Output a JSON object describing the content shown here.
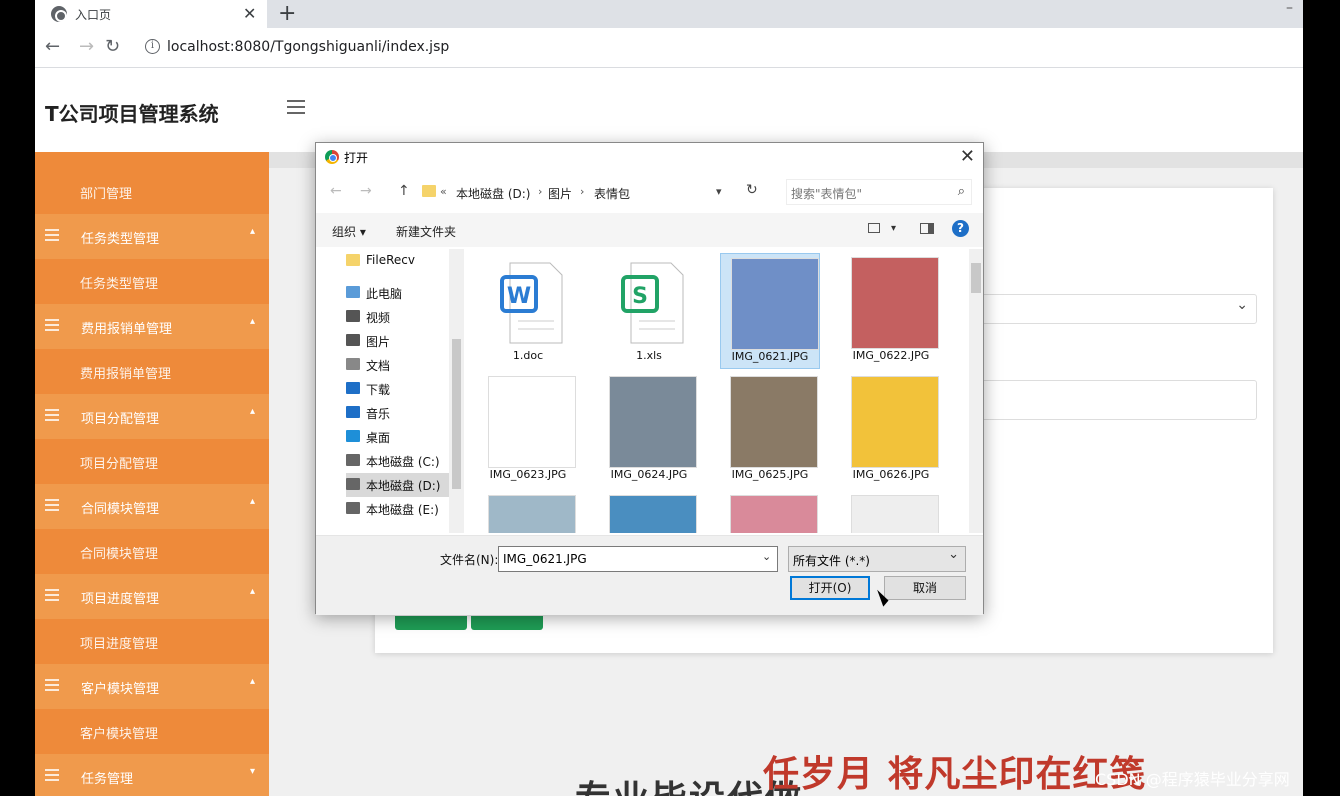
{
  "browser": {
    "tab_title": "入口页",
    "tab_close": "✕",
    "new_tab": "+",
    "url": "localhost:8080/Tgongshiguanli/index.jsp"
  },
  "app": {
    "title": "T公司项目管理系统"
  },
  "sidebar": {
    "items": [
      {
        "label": "部门管理",
        "type": "item"
      },
      {
        "label": "任务类型管理",
        "type": "group"
      },
      {
        "label": "任务类型管理",
        "type": "item"
      },
      {
        "label": "费用报销单管理",
        "type": "group"
      },
      {
        "label": "费用报销单管理",
        "type": "item"
      },
      {
        "label": "项目分配管理",
        "type": "group"
      },
      {
        "label": "项目分配管理",
        "type": "item"
      },
      {
        "label": "合同模块管理",
        "type": "group"
      },
      {
        "label": "合同模块管理",
        "type": "item"
      },
      {
        "label": "项目进度管理",
        "type": "group"
      },
      {
        "label": "项目进度管理",
        "type": "item"
      },
      {
        "label": "客户模块管理",
        "type": "group"
      },
      {
        "label": "客户模块管理",
        "type": "item"
      },
      {
        "label": "任务管理",
        "type": "group"
      }
    ]
  },
  "dialog": {
    "title": "打开",
    "path": [
      "本地磁盘 (D:)",
      "图片",
      "表情包"
    ],
    "search_placeholder": "搜索\"表情包\"",
    "toolbar": {
      "organize": "组织 ▾",
      "new_folder": "新建文件夹",
      "help": "?"
    },
    "nav": [
      {
        "label": "FileRecv",
        "color": "#f5d36a"
      },
      {
        "label": "此电脑",
        "color": "#5a9bd8"
      },
      {
        "label": "视频",
        "color": "#555555"
      },
      {
        "label": "图片",
        "color": "#555555"
      },
      {
        "label": "文档",
        "color": "#888888"
      },
      {
        "label": "下载",
        "color": "#1e6fc7"
      },
      {
        "label": "音乐",
        "color": "#1e6fc7"
      },
      {
        "label": "桌面",
        "color": "#1e8fd8"
      },
      {
        "label": "本地磁盘 (C:)",
        "color": "#666666"
      },
      {
        "label": "本地磁盘 (D:)",
        "color": "#666666"
      },
      {
        "label": "本地磁盘 (E:)",
        "color": "#666666"
      }
    ],
    "files": [
      {
        "name": "1.doc",
        "kind": "doc",
        "color": "#2b7cd3"
      },
      {
        "name": "1.xls",
        "kind": "xls",
        "color": "#21a366"
      },
      {
        "name": "IMG_0621.JPG",
        "kind": "img",
        "color": "#6f8fc7"
      },
      {
        "name": "IMG_0622.JPG",
        "kind": "img",
        "color": "#c46060"
      },
      {
        "name": "IMG_0623.JPG",
        "kind": "img",
        "color": "#ffffff"
      },
      {
        "name": "IMG_0624.JPG",
        "kind": "img",
        "color": "#7a8a99"
      },
      {
        "name": "IMG_0625.JPG",
        "kind": "img",
        "color": "#8a7a66"
      },
      {
        "name": "IMG_0626.JPG",
        "kind": "img",
        "color": "#f2c23a"
      },
      {
        "name": "",
        "kind": "img",
        "color": "#9fb8c8"
      },
      {
        "name": "",
        "kind": "img",
        "color": "#4a8ec0"
      },
      {
        "name": "",
        "kind": "img",
        "color": "#d98a9a"
      },
      {
        "name": "",
        "kind": "img",
        "color": "#eeeeee"
      }
    ],
    "selected_file": "IMG_0621.JPG",
    "filename_label": "文件名(N):",
    "filename_value": "IMG_0621.JPG",
    "filetype": "所有文件 (*.*)",
    "open_label": "打开(O)",
    "cancel_label": "取消"
  },
  "overlay": {
    "banner_red": "任岁月 将凡尘印在红笺",
    "banner_dark": "专业毕设代做",
    "watermark": "CSDN @程序猿毕业分享网"
  }
}
